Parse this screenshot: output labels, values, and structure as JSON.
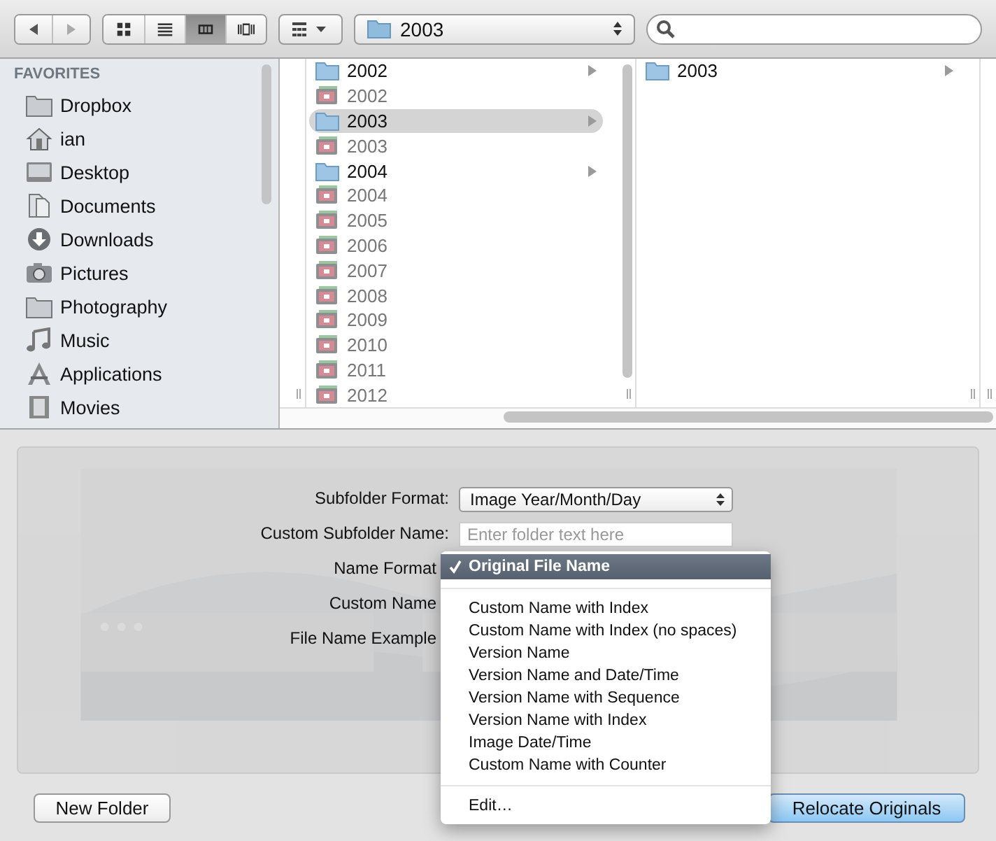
{
  "toolbar": {
    "nav": [
      {
        "kind": "back",
        "disabled": false
      },
      {
        "kind": "forward",
        "disabled": true
      }
    ],
    "views": [
      {
        "kind": "icons",
        "selected": false
      },
      {
        "kind": "list",
        "selected": false
      },
      {
        "kind": "columns",
        "selected": true
      },
      {
        "kind": "coverflow",
        "selected": false
      }
    ],
    "path": {
      "label": "2003"
    }
  },
  "sidebar": {
    "heading": "FAVORITES",
    "items": [
      {
        "label": "Dropbox",
        "kind": "folder"
      },
      {
        "label": "ian",
        "kind": "home"
      },
      {
        "label": "Desktop",
        "kind": "desktop"
      },
      {
        "label": "Documents",
        "kind": "documents"
      },
      {
        "label": "Downloads",
        "kind": "downloads"
      },
      {
        "label": "Pictures",
        "kind": "pictures"
      },
      {
        "label": "Photography",
        "kind": "folder"
      },
      {
        "label": "Music",
        "kind": "music"
      },
      {
        "label": "Applications",
        "kind": "applications"
      },
      {
        "label": "Movies",
        "kind": "movies"
      }
    ]
  },
  "columns": [
    [
      {
        "label": "2002",
        "kind": "folder",
        "selected": false
      },
      {
        "label": "2002",
        "kind": "album",
        "selected": false
      },
      {
        "label": "2003",
        "kind": "folder",
        "selected": true
      },
      {
        "label": "2003",
        "kind": "album",
        "selected": false
      },
      {
        "label": "2004",
        "kind": "folder",
        "selected": false
      },
      {
        "label": "2004",
        "kind": "album",
        "selected": false
      },
      {
        "label": "2005",
        "kind": "album",
        "selected": false
      },
      {
        "label": "2006",
        "kind": "album",
        "selected": false
      },
      {
        "label": "2007",
        "kind": "album",
        "selected": false
      },
      {
        "label": "2008",
        "kind": "album",
        "selected": false
      },
      {
        "label": "2009",
        "kind": "album",
        "selected": false
      },
      {
        "label": "2010",
        "kind": "album",
        "selected": false
      },
      {
        "label": "2011",
        "kind": "album",
        "selected": false
      },
      {
        "label": "2012",
        "kind": "album",
        "selected": false
      }
    ],
    [
      {
        "label": "2003",
        "kind": "folder",
        "selected": false
      }
    ]
  ],
  "form": [
    {
      "label": "Subfolder Format:",
      "kind": "popup",
      "value": "Image Year/Month/Day"
    },
    {
      "label": "Custom Subfolder Name:",
      "kind": "text",
      "placeholder": "Enter folder text here"
    },
    {
      "label": "Name Format",
      "kind": "hidden"
    },
    {
      "label": "Custom Name",
      "kind": "hidden"
    },
    {
      "label": "File Name Example",
      "kind": "hidden"
    }
  ],
  "menu": [
    [
      {
        "label": "Original File Name",
        "checked": true,
        "selected": true
      }
    ],
    [
      {
        "label": "Custom Name with Index",
        "checked": false,
        "selected": false
      },
      {
        "label": "Custom Name with Index (no spaces)",
        "checked": false,
        "selected": false
      },
      {
        "label": "Version Name",
        "checked": false,
        "selected": false
      },
      {
        "label": "Version Name and Date/Time",
        "checked": false,
        "selected": false
      },
      {
        "label": "Version Name with Sequence",
        "checked": false,
        "selected": false
      },
      {
        "label": "Version Name with Index",
        "checked": false,
        "selected": false
      },
      {
        "label": "Image Date/Time",
        "checked": false,
        "selected": false
      },
      {
        "label": "Custom Name with Counter",
        "checked": false,
        "selected": false
      }
    ],
    [
      {
        "label": "Edit…",
        "checked": false,
        "selected": false
      }
    ]
  ],
  "buttons": [
    {
      "label": "New Folder",
      "kind": "normal"
    },
    {
      "label": "Relocate Originals",
      "kind": "default"
    }
  ]
}
